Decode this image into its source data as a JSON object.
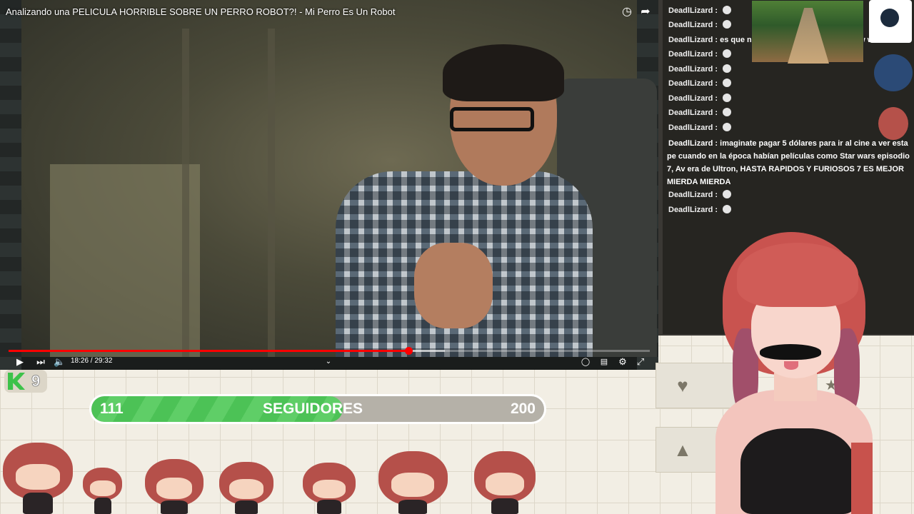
{
  "video": {
    "title": "Analizando una PELICULA HORRIBLE SOBRE UN PERRO ROBOT?! - Mi Perro Es Un Robot",
    "current_time": "18:26",
    "duration": "29:32",
    "time_label": "18:26 / 29:32",
    "progress_fraction": 0.624,
    "buffered_fraction": 0.68,
    "progress_color": "#ff0000",
    "icons": {
      "watch_later": "clock-icon",
      "share": "share-icon",
      "play": "play-icon",
      "next": "next-icon",
      "volume": "volume-icon",
      "chevron": "chevron-down-icon",
      "autoplay": "autoplay-toggle-icon",
      "subtitles": "subtitles-icon",
      "settings": "gear-icon",
      "exit_fullscreen": "exit-fullscreen-icon"
    }
  },
  "chat": {
    "messages": [
      {
        "user": "DeadlLizard",
        "sep": " : ",
        "text": ""
      },
      {
        "user": "DeadlLizard",
        "sep": " : ",
        "text": ""
      },
      {
        "user": "DeadlLizard",
        "sep": " : ",
        "text": "es que no es salado, es cliché w w w w w w w"
      },
      {
        "user": "DeadlLizard",
        "sep": " : ",
        "text": ""
      },
      {
        "user": "DeadlLizard",
        "sep": " : ",
        "text": ""
      },
      {
        "user": "DeadlLizard",
        "sep": " : ",
        "text": ""
      },
      {
        "user": "DeadlLizard",
        "sep": " : ",
        "text": ""
      },
      {
        "user": "DeadlLizard",
        "sep": " : ",
        "text": ""
      },
      {
        "user": "DeadlLizard",
        "sep": " : ",
        "text": ""
      }
    ],
    "long_message": {
      "user": "DeadlLizard",
      "sep": " : ",
      "text": "imaginate pagar 5 dólares para ir al cine a ver esta pe cuando en la época habían películas como Star wars episodio 7, Av era de Ultron, HASTA RAPIDOS Y FURIOSOS 7 ES MEJOR MIERDA MIERDA"
    },
    "after": [
      {
        "user": "DeadlLizard",
        "sep": " : ",
        "text": ""
      },
      {
        "user": "DeadlLizard",
        "sep": " : ",
        "text": ""
      }
    ]
  },
  "followers": {
    "current": "111",
    "label": "SEGUIDORES",
    "goal": "200",
    "fraction": 0.555,
    "bar_color": "#4cc256"
  },
  "badge": {
    "count": "9",
    "icon": "kick-logo-icon"
  },
  "side_panel": {
    "icons": [
      "heart-icon",
      "star-icon",
      "drop-icon"
    ]
  }
}
